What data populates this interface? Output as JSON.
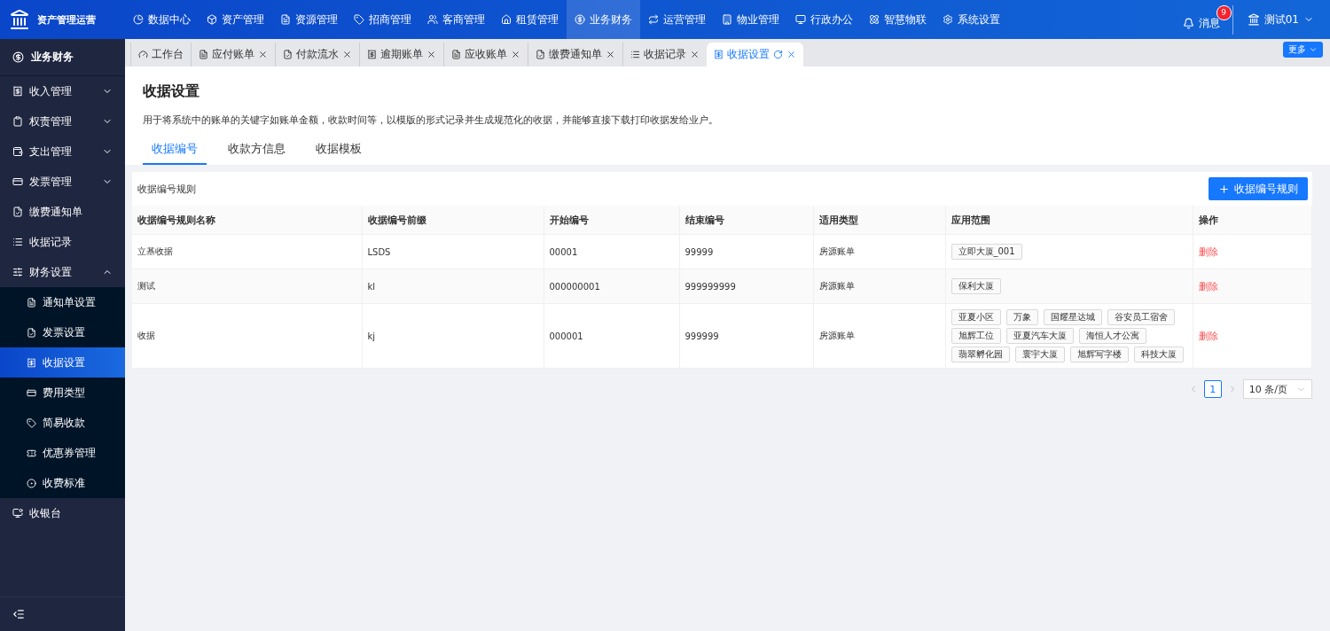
{
  "app": {
    "title": "资产管理运营"
  },
  "top_nav": [
    {
      "label": "数据中心",
      "selected": false
    },
    {
      "label": "资产管理",
      "selected": false
    },
    {
      "label": "资源管理",
      "selected": false
    },
    {
      "label": "招商管理",
      "selected": false
    },
    {
      "label": "客商管理",
      "selected": false
    },
    {
      "label": "租赁管理",
      "selected": false
    },
    {
      "label": "业务财务",
      "selected": true
    },
    {
      "label": "运营管理",
      "selected": false
    },
    {
      "label": "物业管理",
      "selected": false
    },
    {
      "label": "行政办公",
      "selected": false
    },
    {
      "label": "智慧物联",
      "selected": false
    },
    {
      "label": "系统设置",
      "selected": false
    }
  ],
  "notifications": {
    "label": "消息",
    "badge": "9"
  },
  "user": {
    "name": "测试01"
  },
  "sidebar": {
    "header": "业务财务",
    "items": [
      {
        "label": "收入管理",
        "kind": "group",
        "expanded": false,
        "selected": false
      },
      {
        "label": "权责管理",
        "kind": "group",
        "expanded": false,
        "selected": false
      },
      {
        "label": "支出管理",
        "kind": "group",
        "expanded": false,
        "selected": false
      },
      {
        "label": "发票管理",
        "kind": "group",
        "expanded": false,
        "selected": false
      },
      {
        "label": "缴费通知单",
        "kind": "link",
        "selected": false
      },
      {
        "label": "收据记录",
        "kind": "link",
        "selected": false
      },
      {
        "label": "财务设置",
        "kind": "group",
        "expanded": true,
        "selected": false,
        "children": [
          {
            "label": "通知单设置",
            "selected": false
          },
          {
            "label": "发票设置",
            "selected": false
          },
          {
            "label": "收据设置",
            "selected": true
          },
          {
            "label": "费用类型",
            "selected": false
          },
          {
            "label": "简易收款",
            "selected": false
          },
          {
            "label": "优惠券管理",
            "selected": false
          },
          {
            "label": "收费标准",
            "selected": false
          }
        ]
      },
      {
        "label": "收银台",
        "kind": "link",
        "selected": false
      }
    ]
  },
  "tabs": [
    {
      "label": "工作台",
      "selected": false,
      "closable": false
    },
    {
      "label": "应付账单",
      "selected": false,
      "closable": true
    },
    {
      "label": "付款流水",
      "selected": false,
      "closable": true
    },
    {
      "label": "逾期账单",
      "selected": false,
      "closable": true
    },
    {
      "label": "应收账单",
      "selected": false,
      "closable": true
    },
    {
      "label": "缴费通知单",
      "selected": false,
      "closable": true
    },
    {
      "label": "收据记录",
      "selected": false,
      "closable": true
    },
    {
      "label": "收据设置",
      "selected": true,
      "closable": true
    }
  ],
  "more_button": "更多",
  "page": {
    "title": "收据设置",
    "description": "用于将系统中的账单的关键字如账单金额，收款时间等，以模版的形式记录并生成规范化的收据，并能够直接下载打印收据发给业户。",
    "sub_tabs": [
      {
        "label": "收据编号",
        "selected": true
      },
      {
        "label": "收款方信息",
        "selected": false
      },
      {
        "label": "收据模板",
        "selected": false
      }
    ],
    "section_title": "收据编号规则",
    "add_button": "收据编号规则",
    "table": {
      "columns": [
        "收据编号规则名称",
        "收据编号前缀",
        "开始编号",
        "结束编号",
        "适用类型",
        "应用范围",
        "操作"
      ],
      "rows": [
        {
          "name": "立基收据",
          "prefix": "LSDS",
          "start": "00001",
          "end": "99999",
          "type": "房源账单",
          "scope": [
            "立即大厦_001"
          ],
          "action": "删除"
        },
        {
          "name": "测试",
          "prefix": "kl",
          "start": "000000001",
          "end": "999999999",
          "type": "房源账单",
          "scope": [
            "保利大厦"
          ],
          "action": "删除"
        },
        {
          "name": "收据",
          "prefix": "kj",
          "start": "000001",
          "end": "999999",
          "type": "房源账单",
          "scope": [
            "亚夏小区",
            "万象",
            "国耀星达城",
            "谷安员工宿舍",
            "旭辉工位",
            "亚夏汽车大厦",
            "海恒人才公寓",
            "翡翠孵化园",
            "寰宇大厦",
            "旭辉写字楼",
            "科技大厦"
          ],
          "action": "删除"
        }
      ]
    },
    "pagination": {
      "pages": [
        {
          "label": "1",
          "selected": true
        }
      ],
      "page_size": "10 条/页"
    }
  }
}
